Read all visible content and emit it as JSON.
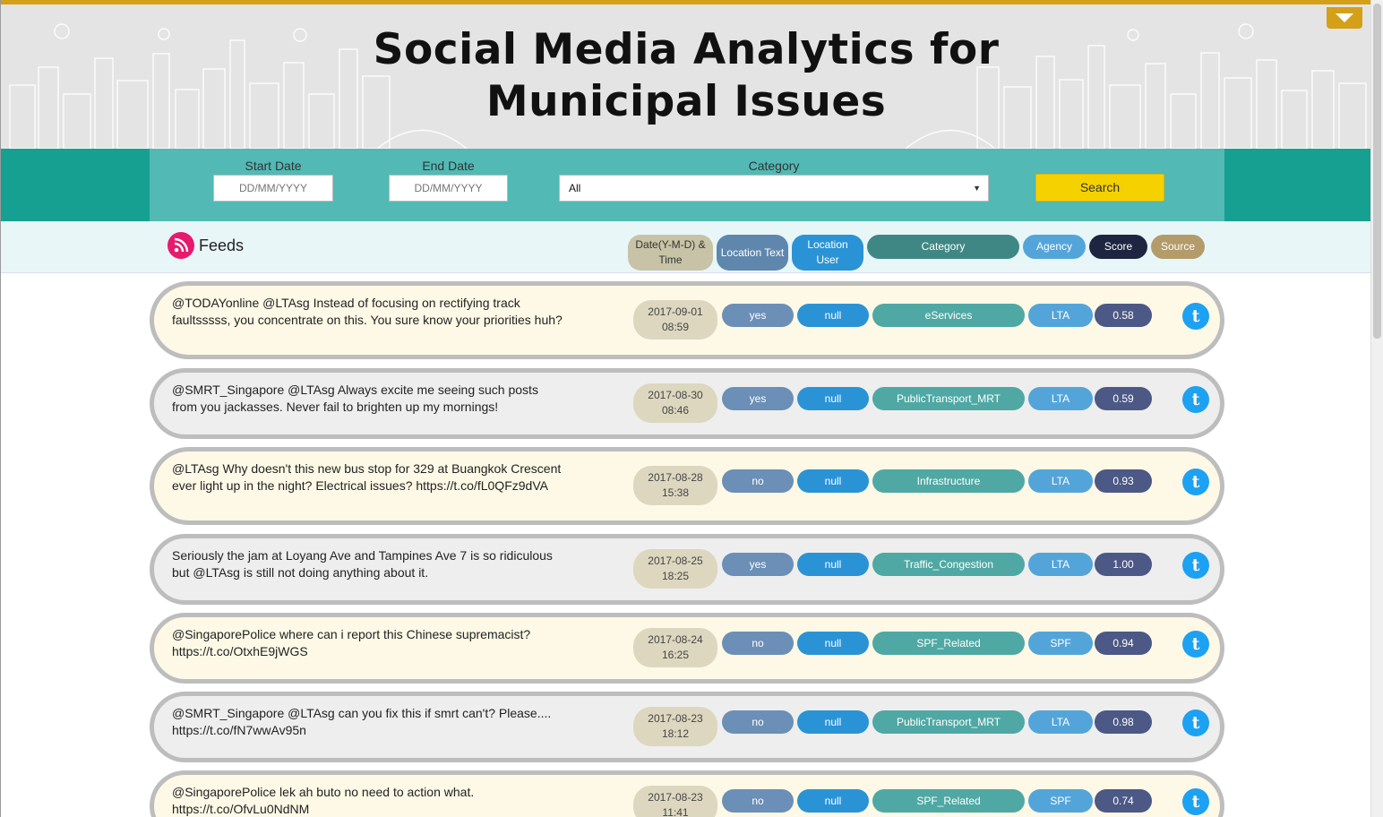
{
  "header": {
    "title_line1": "Social Media Analytics for",
    "title_line2": "Municipal Issues"
  },
  "filters": {
    "start_label": "Start Date",
    "start_placeholder": "DD/MM/YYYY",
    "end_label": "End Date",
    "end_placeholder": "DD/MM/YYYY",
    "category_label": "Category",
    "category_value": "All",
    "search_label": "Search"
  },
  "feeds": {
    "label": "Feeds",
    "columns": [
      "Date(Y-M-D) & Time",
      "Location Text",
      "Location User",
      "Category",
      "Agency",
      "Score",
      "Source"
    ]
  },
  "rows": [
    {
      "text": "@TODAYonline @LTAsg Instead of focusing on rectifying track faultsssss, you concentrate on this. You sure know your priorities huh?",
      "date": "2017-09-01",
      "time": "08:59",
      "loc_text": "yes",
      "loc_user": "null",
      "category": "eServices",
      "agency": "LTA",
      "score": "0.58",
      "source": "twitter-icon"
    },
    {
      "text": "@SMRT_Singapore @LTAsg Always excite me seeing such posts from you jackasses. Never fail to brighten up my mornings!",
      "date": "2017-08-30",
      "time": "08:46",
      "loc_text": "yes",
      "loc_user": "null",
      "category": "PublicTransport_MRT",
      "agency": "LTA",
      "score": "0.59",
      "source": "twitter-icon"
    },
    {
      "text": "@LTAsg Why doesn't this new bus stop for 329 at Buangkok Crescent ever light up in the night? Electrical issues? https://t.co/fL0QFz9dVA",
      "date": "2017-08-28",
      "time": "15:38",
      "loc_text": "no",
      "loc_user": "null",
      "category": "Infrastructure",
      "agency": "LTA",
      "score": "0.93",
      "source": "twitter-icon"
    },
    {
      "text": "Seriously the jam at Loyang Ave and Tampines Ave 7 is so ridiculous but @LTAsg is still not doing anything about it.",
      "date": "2017-08-25",
      "time": "18:25",
      "loc_text": "yes",
      "loc_user": "null",
      "category": "Traffic_Congestion",
      "agency": "LTA",
      "score": "1.00",
      "source": "twitter-icon"
    },
    {
      "text": "@SingaporePolice where can i report this Chinese supremacist? https://t.co/OtxhE9jWGS",
      "date": "2017-08-24",
      "time": "16:25",
      "loc_text": "no",
      "loc_user": "null",
      "category": "SPF_Related",
      "agency": "SPF",
      "score": "0.94",
      "source": "twitter-icon"
    },
    {
      "text": "@SMRT_Singapore @LTAsg can you fix this if smrt can't? Please.... https://t.co/fN7wwAv95n",
      "date": "2017-08-23",
      "time": "18:12",
      "loc_text": "no",
      "loc_user": "null",
      "category": "PublicTransport_MRT",
      "agency": "LTA",
      "score": "0.98",
      "source": "twitter-icon"
    },
    {
      "text": "@SingaporePolice lek ah buto no need to action what. https://t.co/OfvLu0NdNM",
      "date": "2017-08-23",
      "time": "11:41",
      "loc_text": "no",
      "loc_user": "null",
      "category": "SPF_Related",
      "agency": "SPF",
      "score": "0.74",
      "source": "twitter-icon"
    }
  ],
  "colors": {
    "accent": "#d4a017",
    "teal": "#16a091",
    "teal_light": "#52b9b5",
    "search": "#f5d100",
    "rss": "#e8196e",
    "twitter": "#1da1f2"
  }
}
